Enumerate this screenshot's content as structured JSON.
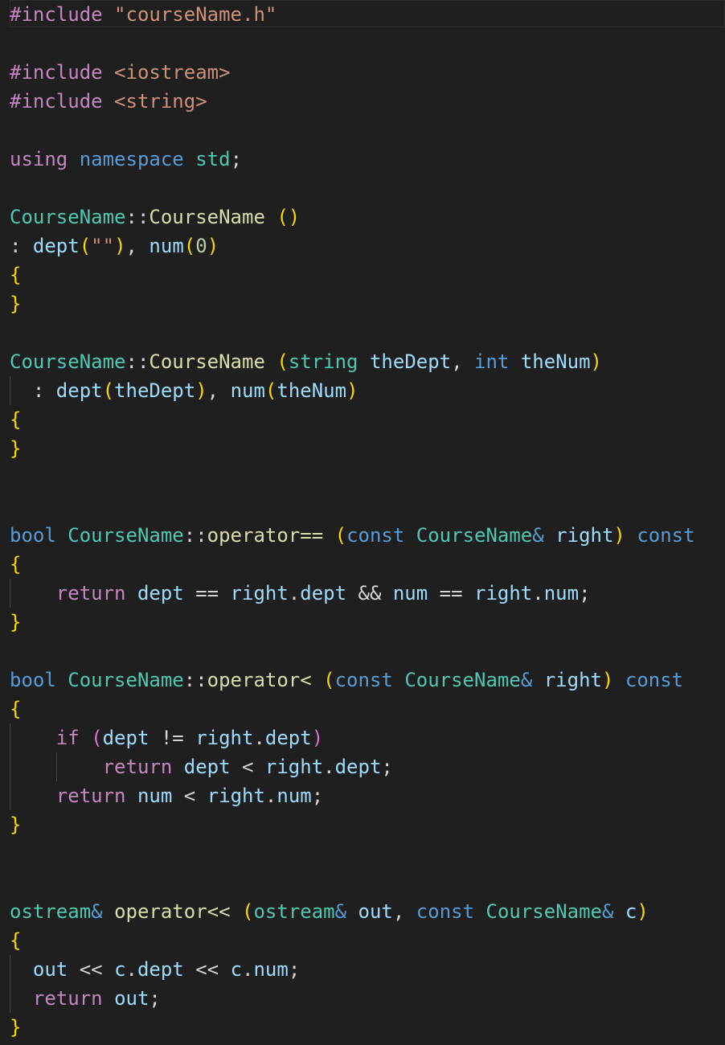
{
  "editor": {
    "language": "C++",
    "theme_colors": {
      "background": "#1f1f1f",
      "directive": "#c586c0",
      "string": "#ce9178",
      "keyword": "#569cd6",
      "control": "#c586c0",
      "type": "#4ec9b0",
      "function": "#dcdcaa",
      "variable": "#9cdcfe",
      "number": "#b5cea8",
      "bracket_level1": "#ffd700",
      "bracket_level2": "#da70d6",
      "punctuation": "#d4d4d4"
    },
    "lines": [
      {
        "row": 0,
        "tokens": [
          {
            "t": "#include ",
            "c": "dir"
          },
          {
            "t": "\"courseName.h\"",
            "c": "str"
          }
        ]
      },
      {
        "row": 2,
        "tokens": [
          {
            "t": "#include ",
            "c": "dir"
          },
          {
            "t": "<iostream>",
            "c": "str"
          }
        ]
      },
      {
        "row": 3,
        "tokens": [
          {
            "t": "#include ",
            "c": "dir"
          },
          {
            "t": "<string>",
            "c": "str"
          }
        ]
      },
      {
        "row": 5,
        "tokens": [
          {
            "t": "using",
            "c": "ctl"
          },
          {
            "t": " ",
            "c": "p"
          },
          {
            "t": "namespace",
            "c": "kw"
          },
          {
            "t": " ",
            "c": "p"
          },
          {
            "t": "std",
            "c": "type"
          },
          {
            "t": ";",
            "c": "p"
          }
        ]
      },
      {
        "row": 7,
        "tokens": [
          {
            "t": "CourseName",
            "c": "type"
          },
          {
            "t": "::",
            "c": "p"
          },
          {
            "t": "CourseName",
            "c": "fn"
          },
          {
            "t": " ",
            "c": "p"
          },
          {
            "t": "()",
            "c": "b1"
          }
        ]
      },
      {
        "row": 8,
        "tokens": [
          {
            "t": ": ",
            "c": "p"
          },
          {
            "t": "dept",
            "c": "var"
          },
          {
            "t": "(",
            "c": "b1"
          },
          {
            "t": "\"\"",
            "c": "str"
          },
          {
            "t": ")",
            "c": "b1"
          },
          {
            "t": ", ",
            "c": "p"
          },
          {
            "t": "num",
            "c": "var"
          },
          {
            "t": "(",
            "c": "b1"
          },
          {
            "t": "0",
            "c": "num"
          },
          {
            "t": ")",
            "c": "b1"
          }
        ]
      },
      {
        "row": 9,
        "tokens": [
          {
            "t": "{",
            "c": "b1"
          }
        ]
      },
      {
        "row": 10,
        "tokens": [
          {
            "t": "}",
            "c": "b1"
          }
        ]
      },
      {
        "row": 12,
        "tokens": [
          {
            "t": "CourseName",
            "c": "type"
          },
          {
            "t": "::",
            "c": "p"
          },
          {
            "t": "CourseName",
            "c": "fn"
          },
          {
            "t": " ",
            "c": "p"
          },
          {
            "t": "(",
            "c": "b1"
          },
          {
            "t": "string",
            "c": "type"
          },
          {
            "t": " ",
            "c": "p"
          },
          {
            "t": "theDept",
            "c": "var"
          },
          {
            "t": ", ",
            "c": "p"
          },
          {
            "t": "int",
            "c": "kw"
          },
          {
            "t": " ",
            "c": "p"
          },
          {
            "t": "theNum",
            "c": "var"
          },
          {
            "t": ")",
            "c": "b1"
          }
        ]
      },
      {
        "row": 13,
        "tokens": [
          {
            "t": "  : ",
            "c": "p"
          },
          {
            "t": "dept",
            "c": "var"
          },
          {
            "t": "(",
            "c": "b1"
          },
          {
            "t": "theDept",
            "c": "var"
          },
          {
            "t": ")",
            "c": "b1"
          },
          {
            "t": ", ",
            "c": "p"
          },
          {
            "t": "num",
            "c": "var"
          },
          {
            "t": "(",
            "c": "b1"
          },
          {
            "t": "theNum",
            "c": "var"
          },
          {
            "t": ")",
            "c": "b1"
          }
        ]
      },
      {
        "row": 14,
        "tokens": [
          {
            "t": "{",
            "c": "b1"
          }
        ]
      },
      {
        "row": 15,
        "tokens": [
          {
            "t": "}",
            "c": "b1"
          }
        ]
      },
      {
        "row": 18,
        "tokens": [
          {
            "t": "bool",
            "c": "kw"
          },
          {
            "t": " ",
            "c": "p"
          },
          {
            "t": "CourseName",
            "c": "type"
          },
          {
            "t": "::",
            "c": "p"
          },
          {
            "t": "operator==",
            "c": "fn"
          },
          {
            "t": " ",
            "c": "p"
          },
          {
            "t": "(",
            "c": "b1"
          },
          {
            "t": "const",
            "c": "kw"
          },
          {
            "t": " ",
            "c": "p"
          },
          {
            "t": "CourseName",
            "c": "type"
          },
          {
            "t": "&",
            "c": "kw"
          },
          {
            "t": " ",
            "c": "p"
          },
          {
            "t": "right",
            "c": "var"
          },
          {
            "t": ")",
            "c": "b1"
          },
          {
            "t": " ",
            "c": "p"
          },
          {
            "t": "const",
            "c": "kw"
          }
        ]
      },
      {
        "row": 19,
        "tokens": [
          {
            "t": "{",
            "c": "b1"
          }
        ]
      },
      {
        "row": 20,
        "tokens": [
          {
            "t": "    ",
            "c": "p"
          },
          {
            "t": "return",
            "c": "ctl"
          },
          {
            "t": " ",
            "c": "p"
          },
          {
            "t": "dept",
            "c": "var"
          },
          {
            "t": " == ",
            "c": "p"
          },
          {
            "t": "right",
            "c": "var"
          },
          {
            "t": ".",
            "c": "p"
          },
          {
            "t": "dept",
            "c": "var"
          },
          {
            "t": " && ",
            "c": "p"
          },
          {
            "t": "num",
            "c": "var"
          },
          {
            "t": " == ",
            "c": "p"
          },
          {
            "t": "right",
            "c": "var"
          },
          {
            "t": ".",
            "c": "p"
          },
          {
            "t": "num",
            "c": "var"
          },
          {
            "t": ";",
            "c": "p"
          }
        ]
      },
      {
        "row": 21,
        "tokens": [
          {
            "t": "}",
            "c": "b1"
          }
        ]
      },
      {
        "row": 23,
        "tokens": [
          {
            "t": "bool",
            "c": "kw"
          },
          {
            "t": " ",
            "c": "p"
          },
          {
            "t": "CourseName",
            "c": "type"
          },
          {
            "t": "::",
            "c": "p"
          },
          {
            "t": "operator<",
            "c": "fn"
          },
          {
            "t": " ",
            "c": "p"
          },
          {
            "t": "(",
            "c": "b1"
          },
          {
            "t": "const",
            "c": "kw"
          },
          {
            "t": " ",
            "c": "p"
          },
          {
            "t": "CourseName",
            "c": "type"
          },
          {
            "t": "&",
            "c": "kw"
          },
          {
            "t": " ",
            "c": "p"
          },
          {
            "t": "right",
            "c": "var"
          },
          {
            "t": ")",
            "c": "b1"
          },
          {
            "t": " ",
            "c": "p"
          },
          {
            "t": "const",
            "c": "kw"
          }
        ]
      },
      {
        "row": 24,
        "tokens": [
          {
            "t": "{",
            "c": "b1"
          }
        ]
      },
      {
        "row": 25,
        "tokens": [
          {
            "t": "    ",
            "c": "p"
          },
          {
            "t": "if",
            "c": "ctl"
          },
          {
            "t": " ",
            "c": "p"
          },
          {
            "t": "(",
            "c": "b2"
          },
          {
            "t": "dept",
            "c": "var"
          },
          {
            "t": " != ",
            "c": "p"
          },
          {
            "t": "right",
            "c": "var"
          },
          {
            "t": ".",
            "c": "p"
          },
          {
            "t": "dept",
            "c": "var"
          },
          {
            "t": ")",
            "c": "b2"
          }
        ]
      },
      {
        "row": 26,
        "tokens": [
          {
            "t": "        ",
            "c": "p"
          },
          {
            "t": "return",
            "c": "ctl"
          },
          {
            "t": " ",
            "c": "p"
          },
          {
            "t": "dept",
            "c": "var"
          },
          {
            "t": " < ",
            "c": "p"
          },
          {
            "t": "right",
            "c": "var"
          },
          {
            "t": ".",
            "c": "p"
          },
          {
            "t": "dept",
            "c": "var"
          },
          {
            "t": ";",
            "c": "p"
          }
        ]
      },
      {
        "row": 27,
        "tokens": [
          {
            "t": "    ",
            "c": "p"
          },
          {
            "t": "return",
            "c": "ctl"
          },
          {
            "t": " ",
            "c": "p"
          },
          {
            "t": "num",
            "c": "var"
          },
          {
            "t": " < ",
            "c": "p"
          },
          {
            "t": "right",
            "c": "var"
          },
          {
            "t": ".",
            "c": "p"
          },
          {
            "t": "num",
            "c": "var"
          },
          {
            "t": ";",
            "c": "p"
          }
        ]
      },
      {
        "row": 28,
        "tokens": [
          {
            "t": "}",
            "c": "b1"
          }
        ]
      },
      {
        "row": 31,
        "tokens": [
          {
            "t": "ostream",
            "c": "type"
          },
          {
            "t": "&",
            "c": "kw"
          },
          {
            "t": " ",
            "c": "p"
          },
          {
            "t": "operator<<",
            "c": "fn"
          },
          {
            "t": " ",
            "c": "p"
          },
          {
            "t": "(",
            "c": "b1"
          },
          {
            "t": "ostream",
            "c": "type"
          },
          {
            "t": "&",
            "c": "kw"
          },
          {
            "t": " ",
            "c": "p"
          },
          {
            "t": "out",
            "c": "var"
          },
          {
            "t": ", ",
            "c": "p"
          },
          {
            "t": "const",
            "c": "kw"
          },
          {
            "t": " ",
            "c": "p"
          },
          {
            "t": "CourseName",
            "c": "type"
          },
          {
            "t": "&",
            "c": "kw"
          },
          {
            "t": " ",
            "c": "p"
          },
          {
            "t": "c",
            "c": "var"
          },
          {
            "t": ")",
            "c": "b1"
          }
        ]
      },
      {
        "row": 32,
        "tokens": [
          {
            "t": "{",
            "c": "b1"
          }
        ]
      },
      {
        "row": 33,
        "tokens": [
          {
            "t": "  ",
            "c": "p"
          },
          {
            "t": "out",
            "c": "var"
          },
          {
            "t": " << ",
            "c": "p"
          },
          {
            "t": "c",
            "c": "var"
          },
          {
            "t": ".",
            "c": "p"
          },
          {
            "t": "dept",
            "c": "var"
          },
          {
            "t": " << ",
            "c": "p"
          },
          {
            "t": "c",
            "c": "var"
          },
          {
            "t": ".",
            "c": "p"
          },
          {
            "t": "num",
            "c": "var"
          },
          {
            "t": ";",
            "c": "p"
          }
        ]
      },
      {
        "row": 34,
        "tokens": [
          {
            "t": "  ",
            "c": "p"
          },
          {
            "t": "return",
            "c": "ctl"
          },
          {
            "t": " ",
            "c": "p"
          },
          {
            "t": "out",
            "c": "var"
          },
          {
            "t": ";",
            "c": "p"
          }
        ]
      },
      {
        "row": 35,
        "tokens": [
          {
            "t": "}",
            "c": "b1"
          }
        ]
      }
    ]
  }
}
